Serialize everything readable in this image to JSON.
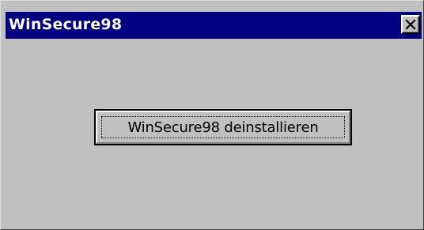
{
  "window": {
    "title": "WinSecure98",
    "close_icon": "close-x-icon"
  },
  "main": {
    "uninstall_button_label": "WinSecure98 deinstallieren"
  },
  "colors": {
    "titlebar": "#000080",
    "face": "#c0c0c0",
    "title_text": "#ffffff"
  }
}
